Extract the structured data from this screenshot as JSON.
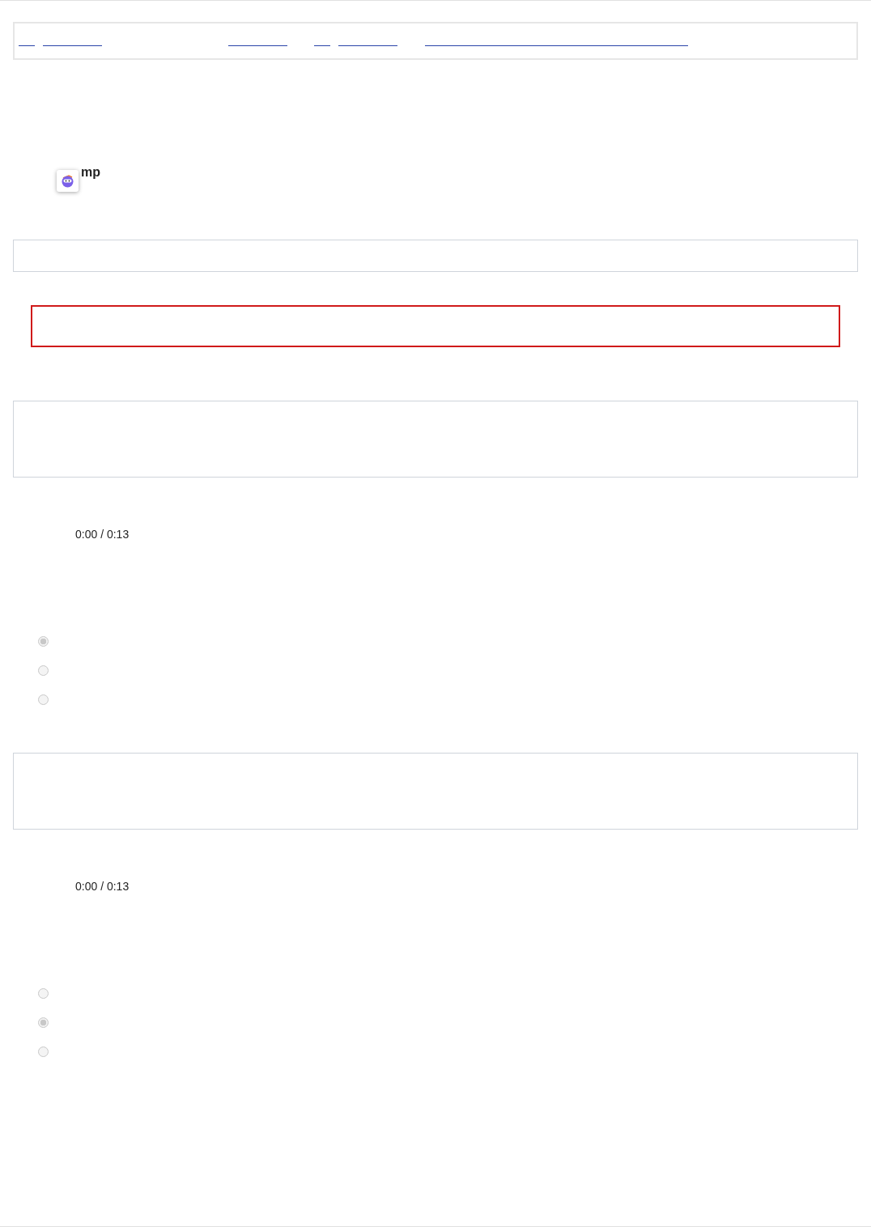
{
  "nav": {
    "links": [
      {
        "kind": "short"
      },
      {
        "kind": "medium"
      },
      {
        "kind": "medium"
      },
      {
        "kind": "short"
      },
      {
        "kind": "medium"
      },
      {
        "kind": "long"
      }
    ]
  },
  "heading": "mp",
  "questions": [
    {
      "time": "0:00 / 0:13",
      "options": [
        {
          "selected": true
        },
        {
          "selected": false
        },
        {
          "selected": false
        }
      ]
    },
    {
      "time": "0:00 / 0:13",
      "options": [
        {
          "selected": false
        },
        {
          "selected": true
        },
        {
          "selected": false
        }
      ]
    }
  ]
}
